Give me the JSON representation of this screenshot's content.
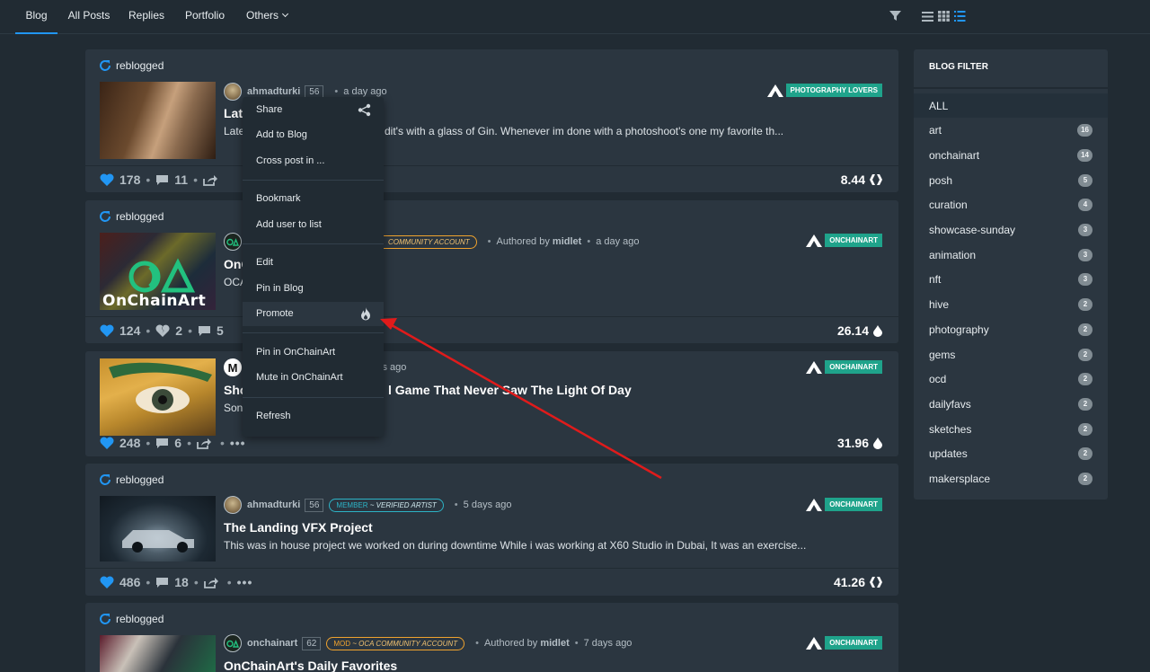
{
  "nav": {
    "tabs": [
      {
        "label": "Blog"
      },
      {
        "label": "All Posts"
      },
      {
        "label": "Replies"
      },
      {
        "label": "Portfolio"
      },
      {
        "label": "Others"
      }
    ],
    "tools": [
      "filter-icon",
      "list-view-icon",
      "grid-view-icon",
      "compact-list-icon"
    ]
  },
  "posts": [
    {
      "reblog_label": "reblogged",
      "author": "ahmadturki",
      "rep": "56",
      "time": "a day ago",
      "title": "Lat",
      "excerpt_left": "Late",
      "excerpt": "dit's with a glass of Gin. Whenever im done with a photoshoot's one my favorite th...",
      "community": "PHOTOGRAPHY LOVERS",
      "votes": "178",
      "comments": "11",
      "payout": "8.44"
    },
    {
      "reblog_label": "reblogged",
      "badge": "COMMUNITY ACCOUNT",
      "authored_prefix": "Authored by",
      "authored_by": "midlet",
      "time": "a day ago",
      "title": "OnC",
      "excerpt": "OCA",
      "thumb_text": "OnChainArt",
      "community": "ONCHAINART",
      "votes": "124",
      "downvotes": "2",
      "comments": "5",
      "payout": "26.14"
    },
    {
      "time": "ys ago",
      "title_left": "Sho",
      "title": "l Game That Never Saw The Light Of Day",
      "excerpt": "Son",
      "community": "ONCHAINART",
      "votes": "248",
      "comments": "6",
      "payout": "31.96"
    },
    {
      "reblog_label": "reblogged",
      "author": "ahmadturki",
      "rep": "56",
      "badge_role": "MEMBER",
      "badge_title": "~ VERIFIED ARTIST",
      "time": "5 days ago",
      "title": "The Landing VFX Project",
      "excerpt": "This was in house project we worked on during downtime While i was working at X60 Studio in Dubai, It was an exercise...",
      "community": "ONCHAINART",
      "votes": "486",
      "comments": "18",
      "payout": "41.26"
    },
    {
      "reblog_label": "reblogged",
      "author": "onchainart",
      "rep": "62",
      "badge_role": "MOD",
      "badge_title": "~ OCA COMMUNITY ACCOUNT",
      "authored_prefix": "Authored by",
      "authored_by": "midlet",
      "time": "7 days ago",
      "title": "OnChainArt's Daily Favorites",
      "community": "ONCHAINART"
    }
  ],
  "sidebar": {
    "title": "BLOG FILTER",
    "items": [
      {
        "label": "ALL",
        "count": ""
      },
      {
        "label": "art",
        "count": "16"
      },
      {
        "label": "onchainart",
        "count": "14"
      },
      {
        "label": "posh",
        "count": "5"
      },
      {
        "label": "curation",
        "count": "4"
      },
      {
        "label": "showcase-sunday",
        "count": "3"
      },
      {
        "label": "animation",
        "count": "3"
      },
      {
        "label": "nft",
        "count": "3"
      },
      {
        "label": "hive",
        "count": "2"
      },
      {
        "label": "photography",
        "count": "2"
      },
      {
        "label": "gems",
        "count": "2"
      },
      {
        "label": "ocd",
        "count": "2"
      },
      {
        "label": "dailyfavs",
        "count": "2"
      },
      {
        "label": "sketches",
        "count": "2"
      },
      {
        "label": "updates",
        "count": "2"
      },
      {
        "label": "makersplace",
        "count": "2"
      }
    ]
  },
  "menu": {
    "items": [
      {
        "label": "Share",
        "icon": "share-icon"
      },
      {
        "label": "Add to Blog"
      },
      {
        "label": "Cross post in ..."
      },
      {
        "label": "Bookmark"
      },
      {
        "label": "Add user to list"
      },
      {
        "label": "Edit"
      },
      {
        "label": "Pin in Blog"
      },
      {
        "label": "Promote",
        "icon": "fire-icon"
      },
      {
        "label": "Pin in OnChainArt"
      },
      {
        "label": "Mute in OnChainArt"
      },
      {
        "label": "Refresh"
      }
    ]
  },
  "colors": {
    "accent": "#2196f3",
    "community_tag": "#1fa38b",
    "annotation_arrow": "#e01b1b"
  }
}
